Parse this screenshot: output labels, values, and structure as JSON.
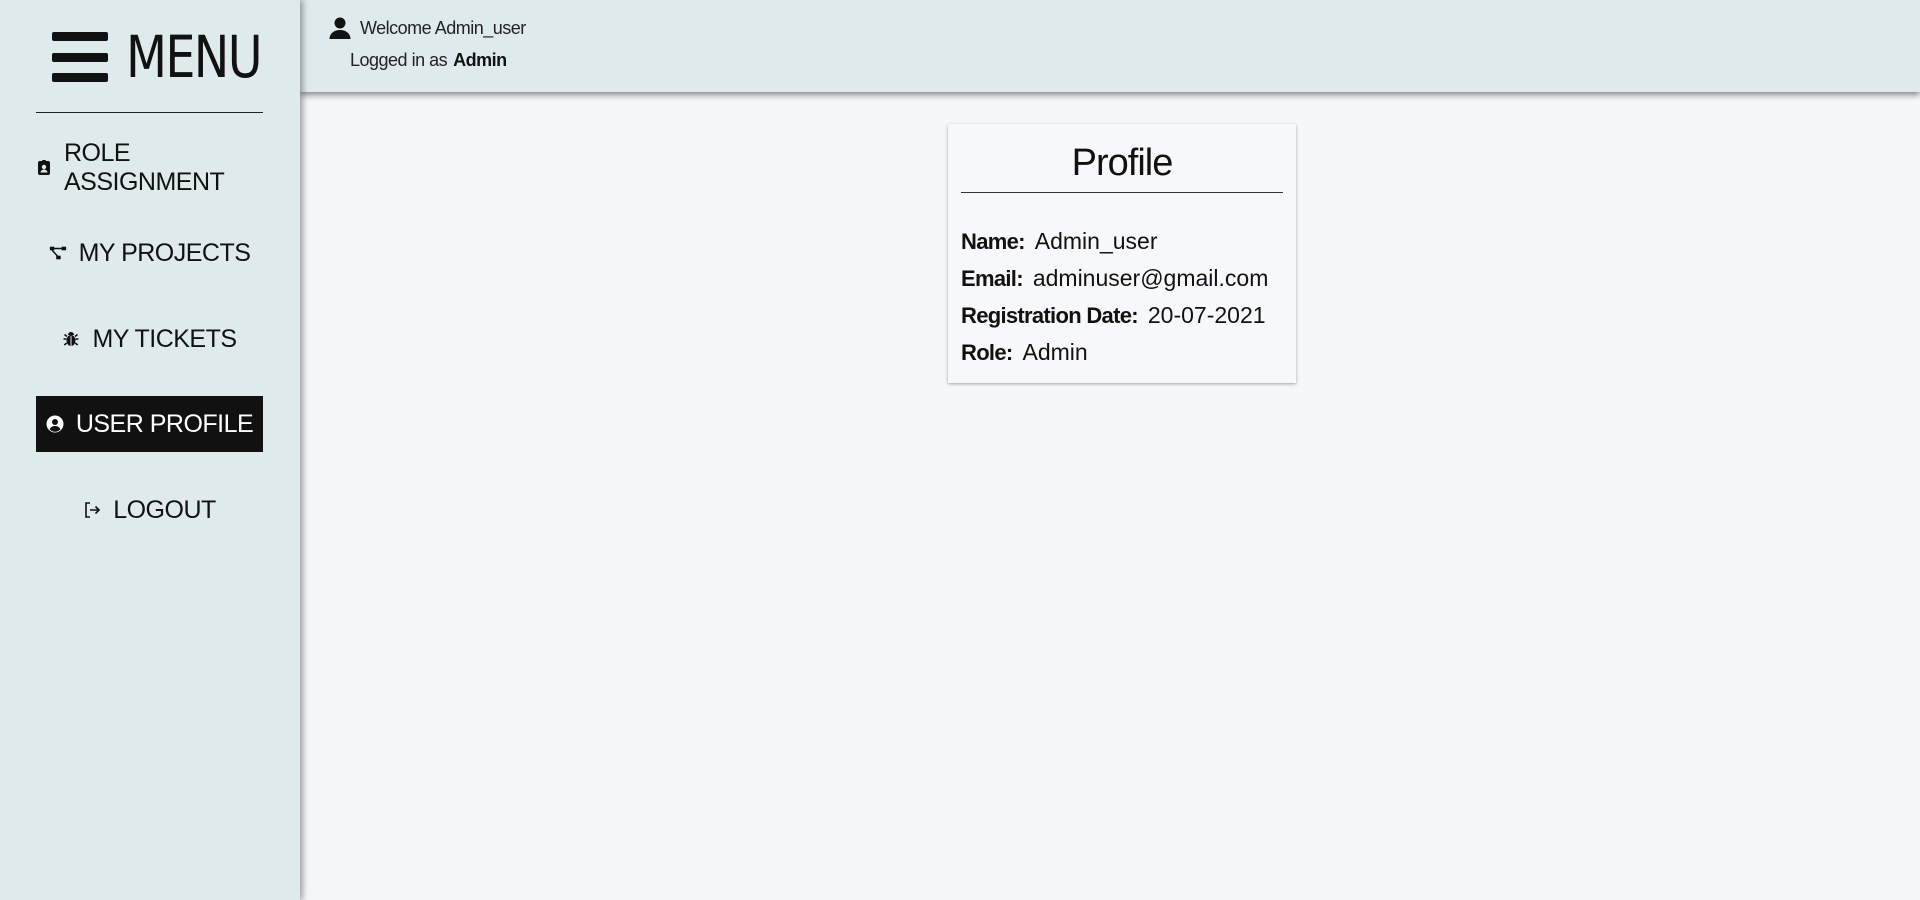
{
  "sidebar": {
    "title": "MENU",
    "items": [
      {
        "label": "ROLE ASSIGNMENT",
        "icon": "id-badge-icon",
        "active": false
      },
      {
        "label": "MY PROJECTS",
        "icon": "project-diagram-icon",
        "active": false
      },
      {
        "label": "MY TICKETS",
        "icon": "bug-icon",
        "active": false
      },
      {
        "label": "USER PROFILE",
        "icon": "user-circle-icon",
        "active": true
      },
      {
        "label": "LOGOUT",
        "icon": "logout-icon",
        "active": false
      }
    ]
  },
  "header": {
    "welcome": "Welcome Admin_user",
    "logged_in_prefix": "Logged in as",
    "role": "Admin"
  },
  "profile": {
    "title": "Profile",
    "fields": [
      {
        "label": "Name:",
        "value": "Admin_user"
      },
      {
        "label": "Email:",
        "value": "adminuser@gmail.com"
      },
      {
        "label": "Registration Date:",
        "value": "20-07-2021"
      },
      {
        "label": "Role:",
        "value": "Admin"
      }
    ]
  },
  "colors": {
    "sidebar_bg": "#dfeaed",
    "content_bg": "#f5f7fb",
    "active_bg": "#111111",
    "active_text": "#ffffff"
  }
}
